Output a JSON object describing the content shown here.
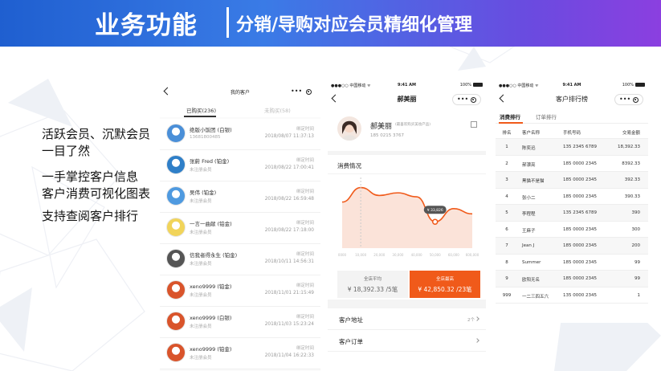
{
  "banner": {
    "title": "业务功能",
    "subtitle": "分销/导购对应会员精细化管理"
  },
  "features": [
    "活跃会员、沉默会员一目了然",
    "一手掌控客户信息",
    "客户消费可视化图表",
    "支持查阅客户排行"
  ],
  "screen1": {
    "title": "我的客户",
    "tabs": [
      {
        "label": "已购买(236)",
        "active": true
      },
      {
        "label": "未购买(58)",
        "active": false
      }
    ],
    "rows": [
      {
        "name": "绝版小饭团 (白银)",
        "sub": "13681800485",
        "tag": "绑定时间",
        "time": "2018/08/07 11:37:13",
        "avatar_color": "#4a8fd8"
      },
      {
        "name": "张蔚 Fred (铂金)",
        "sub": "未注册会员",
        "tag": "绑定时间",
        "time": "2018/08/22 17:00:41",
        "avatar_color": "#2f7fc8"
      },
      {
        "name": "吴伟 (铂金)",
        "sub": "未注册会员",
        "tag": "绑定时间",
        "time": "2018/08/22 16:59:48",
        "avatar_color": "#4f9ae0"
      },
      {
        "name": "一言一曲献 (铂金)",
        "sub": "未注册会员",
        "tag": "绑定时间",
        "time": "2018/08/22 17:18:00",
        "avatar_color": "#f1d45a"
      },
      {
        "name": "信我者得永生 (铂金)",
        "sub": "未注册会员",
        "tag": "绑定时间",
        "time": "2018/10/11 14:56:31",
        "avatar_color": "#555555"
      },
      {
        "name": "xeno9999 (铂金)",
        "sub": "未注册会员",
        "tag": "绑定时间",
        "time": "2018/11/01 21:15:49",
        "avatar_color": "#d9542b"
      },
      {
        "name": "xeno9999 (白银)",
        "sub": "未注册会员",
        "tag": "绑定时间",
        "time": "2018/11/03 15:23:24",
        "avatar_color": "#d9542b"
      },
      {
        "name": "xeno9999 (铂金)",
        "sub": "未注册会员",
        "tag": "绑定时间",
        "time": "2018/11/04 16:22:33",
        "avatar_color": "#d9542b"
      }
    ]
  },
  "screen2": {
    "status": {
      "carrier": "●●●○○ 中国移动 ᯤ",
      "time": "9:41 AM",
      "battery": "100%"
    },
    "title": "郝美丽",
    "profile": {
      "name": "郝美丽",
      "tag": "(最喜欢购买美妆产品)",
      "phone": "185 0215 3767"
    },
    "chart_section": "消费情况",
    "chart_data": {
      "type": "area",
      "x": [
        "0000",
        "10,000",
        "20,000",
        "30,000",
        "40,000",
        "50,000",
        "60,000",
        "600,000"
      ],
      "values": [
        70,
        92,
        80,
        84,
        78,
        40,
        60,
        52
      ],
      "highlight_label": "¥ 33,826",
      "accent": "#f05a1a"
    },
    "cards": [
      {
        "label": "全店平均",
        "value": "¥ 18,392.33 /5笔"
      },
      {
        "label": "全店最高",
        "value": "¥ 42,850.32 /23笔"
      }
    ],
    "menu": [
      {
        "label": "客户地址",
        "right": "2个"
      },
      {
        "label": "客户订单",
        "right": ""
      }
    ]
  },
  "screen3": {
    "status": {
      "carrier": "●●●○○ 中国移动 ᯤ",
      "time": "9:41 AM",
      "battery": "100%"
    },
    "title": "客户排行榜",
    "tabs": [
      {
        "label": "消费排行",
        "active": true
      },
      {
        "label": "订单排行",
        "active": false
      }
    ],
    "columns": [
      "排名",
      "客户名称",
      "手机号码",
      "交易金额"
    ],
    "rows": [
      {
        "rank": "1",
        "name": "陈奕迅",
        "phone": "135 2345 6789",
        "amount": "18,392.33"
      },
      {
        "rank": "2",
        "name": "郝漂亮",
        "phone": "185 0000 2345",
        "amount": "8392.33"
      },
      {
        "rank": "3",
        "name": "黑猫不是猫",
        "phone": "185 0000 2345",
        "amount": "392.33"
      },
      {
        "rank": "4",
        "name": "张小二",
        "phone": "185 0000 2345",
        "amount": "390.33"
      },
      {
        "rank": "5",
        "name": "李程程",
        "phone": "135 2345 6789",
        "amount": "390"
      },
      {
        "rank": "6",
        "name": "王麻子",
        "phone": "185 0000 2345",
        "amount": "300"
      },
      {
        "rank": "7",
        "name": "Jean J",
        "phone": "185 0000 2345",
        "amount": "200"
      },
      {
        "rank": "8",
        "name": "Summer",
        "phone": "185 0000 2345",
        "amount": "99"
      },
      {
        "rank": "9",
        "name": "欧阳无名",
        "phone": "185 0000 2345",
        "amount": "99"
      },
      {
        "rank": "999",
        "name": "一二三四五六",
        "phone": "135 0000 2345",
        "amount": "1"
      }
    ]
  }
}
